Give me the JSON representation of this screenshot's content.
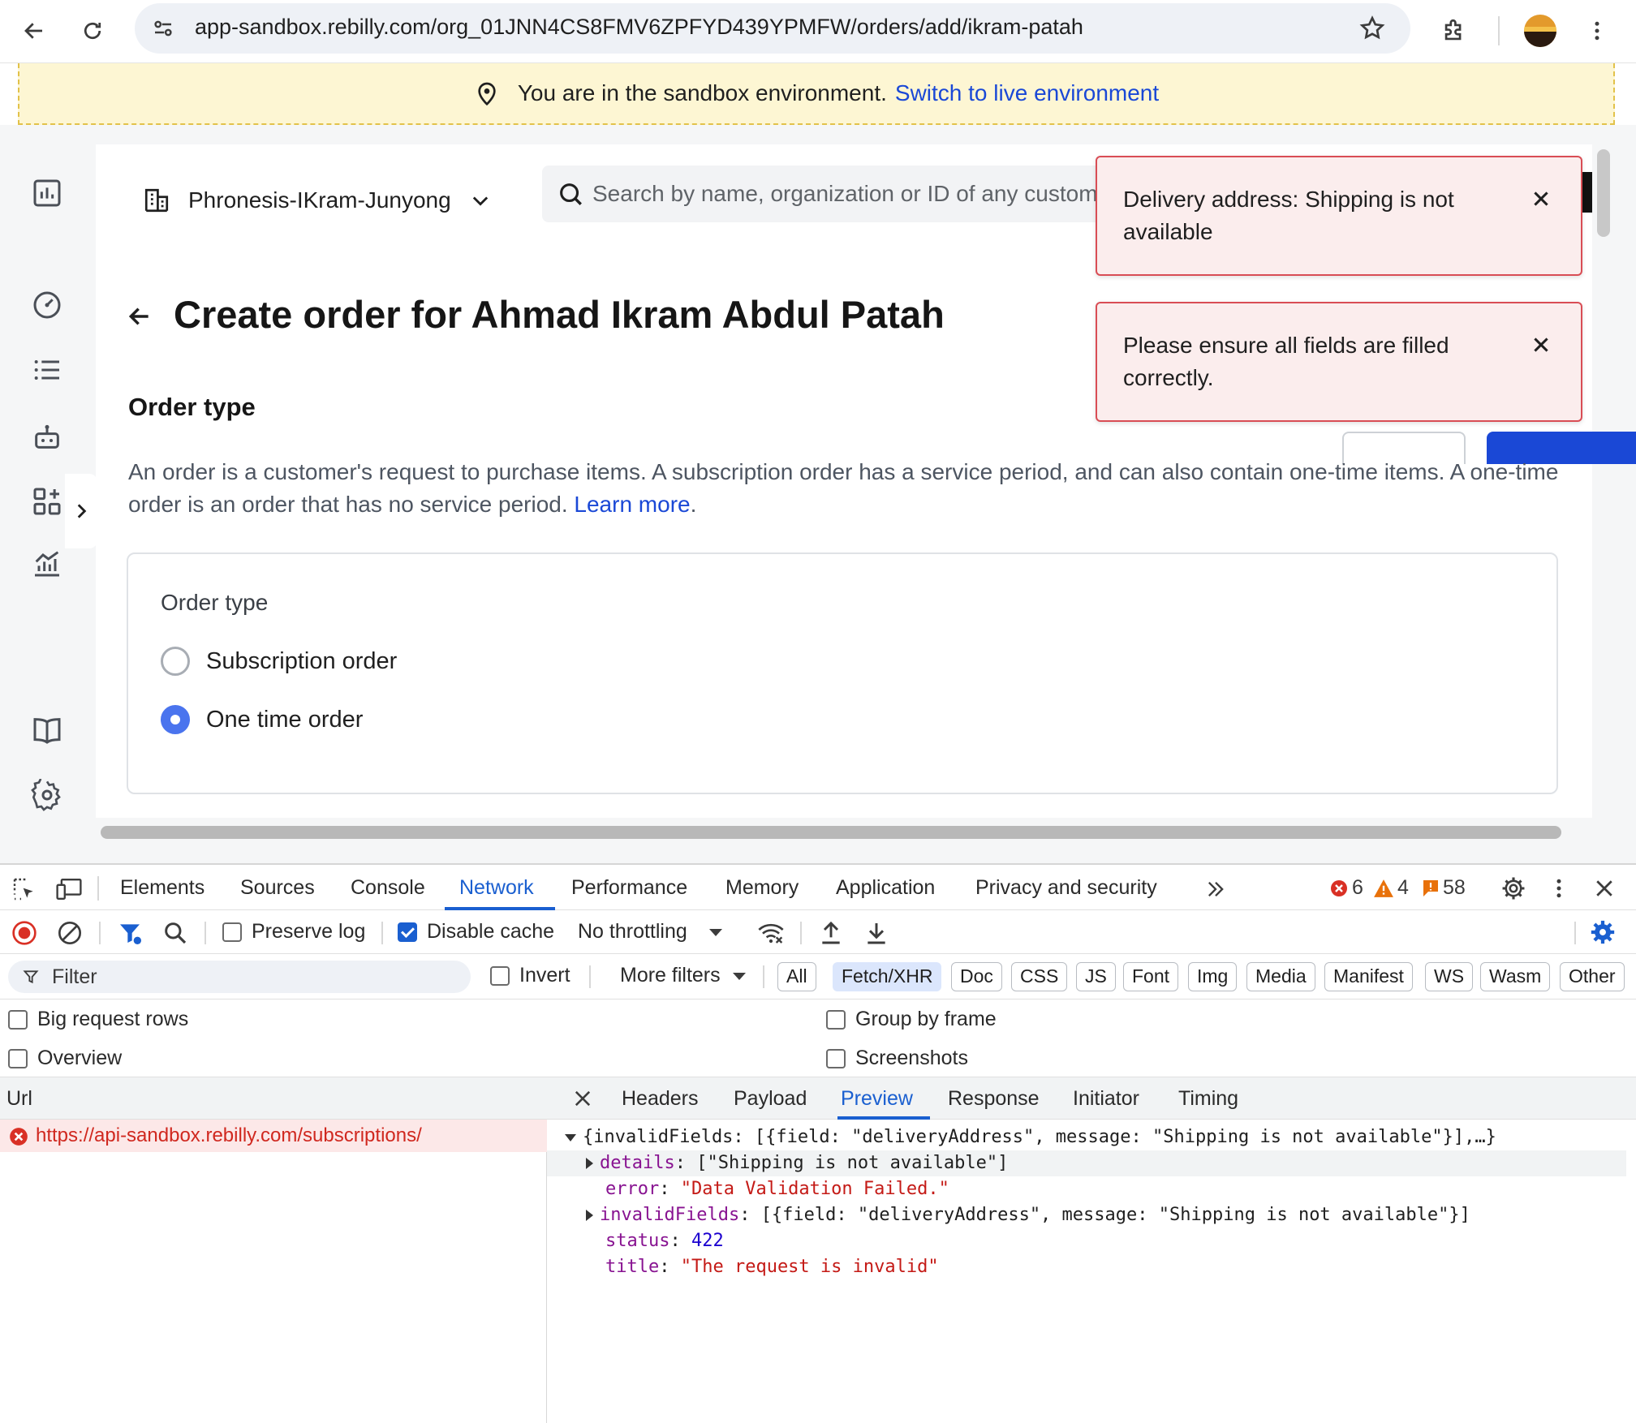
{
  "browser": {
    "url": "app-sandbox.rebilly.com/org_01JNN4CS8FMV6ZPFYD439YPMFW/orders/add/ikram-patah"
  },
  "banner": {
    "message": "You are in the sandbox environment.",
    "link": "Switch to live environment"
  },
  "app": {
    "org_name": "Phronesis-IKram-Junyong",
    "search_placeholder": "Search by name, organization or ID of any customer",
    "page_title": "Create order for Ahmad Ikram Abdul Patah",
    "section_title": "Order type",
    "description": "An order is a customer's request to purchase items. A subscription order has a service period, and can also contain one-time items. A one-time order is an order that has no service period.",
    "description_link": "Learn more",
    "description_end": ".",
    "order_type_label": "Order type",
    "options": [
      {
        "label": "Subscription order",
        "selected": false
      },
      {
        "label": "One time order",
        "selected": true
      }
    ]
  },
  "toasts": [
    {
      "text": "Delivery address: Shipping is not available"
    },
    {
      "text": "Please ensure all fields are filled correctly."
    }
  ],
  "devtools": {
    "tabs": [
      "Elements",
      "Sources",
      "Console",
      "Network",
      "Performance",
      "Memory",
      "Application",
      "Privacy and security"
    ],
    "active_tab": "Network",
    "counts": {
      "errors": "6",
      "warnings": "4",
      "issues": "58"
    },
    "toolbar": {
      "preserve_log": "Preserve log",
      "disable_cache": "Disable cache",
      "throttling": "No throttling"
    },
    "filter": {
      "placeholder": "Filter",
      "invert": "Invert",
      "more_filters": "More filters",
      "types": [
        "All",
        "Fetch/XHR",
        "Doc",
        "CSS",
        "JS",
        "Font",
        "Img",
        "Media",
        "Manifest",
        "WS",
        "Wasm",
        "Other"
      ],
      "active_type": "Fetch/XHR"
    },
    "options": {
      "big_request_rows": "Big request rows",
      "overview": "Overview",
      "group_by_frame": "Group by frame",
      "screenshots": "Screenshots"
    },
    "request_list": {
      "header": "Url",
      "rows": [
        "https://api-sandbox.rebilly.com/subscriptions/"
      ]
    },
    "detail_tabs": [
      "Headers",
      "Payload",
      "Preview",
      "Response",
      "Initiator",
      "Timing"
    ],
    "active_detail_tab": "Preview",
    "preview": {
      "summary": "{invalidFields: [{field: \"deliveryAddress\", message: \"Shipping is not available\"}],…}",
      "details_key": "details",
      "details_value": "[\"Shipping is not available\"]",
      "error_key": "error",
      "error_value": "\"Data Validation Failed.\"",
      "invalid_key": "invalidFields",
      "invalid_value": "[{field: \"deliveryAddress\", message: \"Shipping is not available\"}]",
      "status_key": "status",
      "status_value": "422",
      "title_key": "title",
      "title_value": "\"The request is invalid\""
    }
  }
}
